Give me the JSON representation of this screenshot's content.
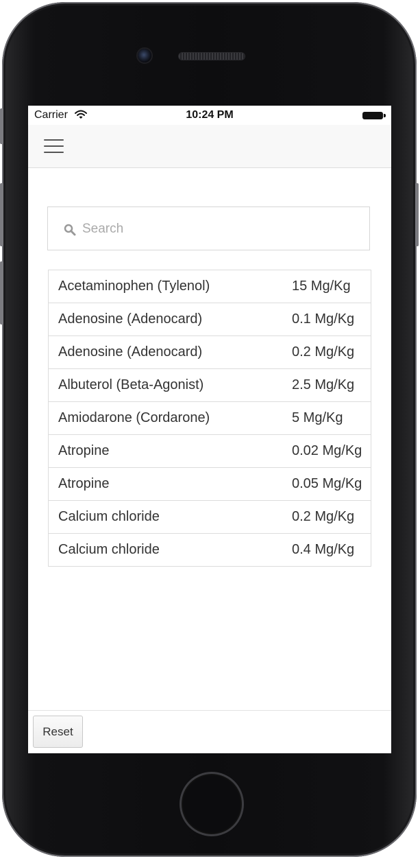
{
  "status_bar": {
    "carrier": "Carrier",
    "time": "10:24 PM"
  },
  "navbar": {
    "menu_icon": "hamburger-menu-icon"
  },
  "search": {
    "placeholder": "Search",
    "value": "",
    "icon": "search-icon"
  },
  "drugs": [
    {
      "name": "Acetaminophen (Tylenol)",
      "dose": "15 Mg/Kg"
    },
    {
      "name": "Adenosine (Adenocard)",
      "dose": "0.1 Mg/Kg"
    },
    {
      "name": "Adenosine (Adenocard)",
      "dose": "0.2 Mg/Kg"
    },
    {
      "name": "Albuterol (Beta-Agonist)",
      "dose": "2.5 Mg/Kg"
    },
    {
      "name": "Amiodarone (Cordarone)",
      "dose": "5 Mg/Kg"
    },
    {
      "name": "Atropine",
      "dose": "0.02 Mg/Kg"
    },
    {
      "name": "Atropine",
      "dose": "0.05 Mg/Kg"
    },
    {
      "name": "Calcium chloride",
      "dose": "0.2 Mg/Kg"
    },
    {
      "name": "Calcium chloride",
      "dose": "0.4 Mg/Kg"
    }
  ],
  "footer": {
    "reset_label": "Reset"
  }
}
